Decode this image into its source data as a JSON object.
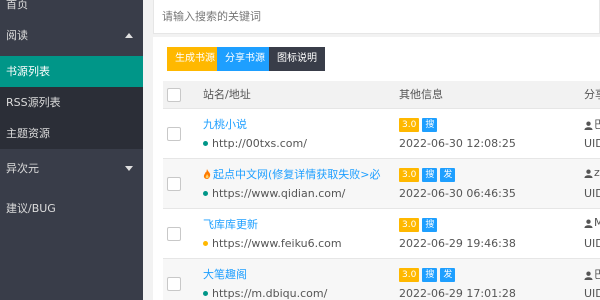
{
  "sidebar": {
    "home": "首页",
    "reading": "阅读",
    "book_source_list": "书源列表",
    "rss_source_list": "RSS源列表",
    "theme_resources": "主题资源",
    "other_dimension": "异次元",
    "feedback": "建议/BUG"
  },
  "search": {
    "placeholder": "请输入搜索的关键词"
  },
  "toolbar": {
    "generate": "生成书源",
    "share": "分享书源",
    "legend": "图标说明"
  },
  "table": {
    "columns": [
      "站名/地址",
      "其他信息",
      "分享者"
    ],
    "rows": [
      {
        "name": "九桃小说",
        "url": "http://00txs.com/",
        "dot": "teal",
        "version": "3.0",
        "sou": "搜",
        "fa": "",
        "time": "2022-06-30 12:08:25",
        "sharer": "巴山",
        "uid": "UID:"
      },
      {
        "name": "起点中文网(修复详情获取失败>必",
        "url": "https://www.qidian.com/",
        "dot": "teal",
        "hot": true,
        "version": "3.0",
        "sou": "搜",
        "fa": "发",
        "time": "2022-06-30 06:46:35",
        "sharer": "zui",
        "uid": "UID:"
      },
      {
        "name": "飞库库更新",
        "url": "https://www.feiku6.com",
        "dot": "orange",
        "version": "3.0",
        "sou": "搜",
        "fa": "",
        "time": "2022-06-29 19:46:38",
        "sharer": "Ma",
        "uid": "UID:"
      },
      {
        "name": "大笔趣阁",
        "url": "https://m.dbiqu.com/",
        "dot": "teal",
        "version": "3.0",
        "sou": "搜",
        "fa": "发",
        "time": "2022-06-29 17:01:28",
        "sharer": "巴山",
        "uid": "UID:"
      }
    ]
  },
  "colors": {
    "sidebar_bg": "#393d49",
    "active": "#009688",
    "version_badge": "#ffb800",
    "blue_badge": "#1e9fff",
    "link": "#1e9fff"
  },
  "icons": {
    "reading_caret": "caret-up-icon",
    "other_caret": "caret-down-icon",
    "user": "user-icon",
    "hot": "fire-icon"
  }
}
